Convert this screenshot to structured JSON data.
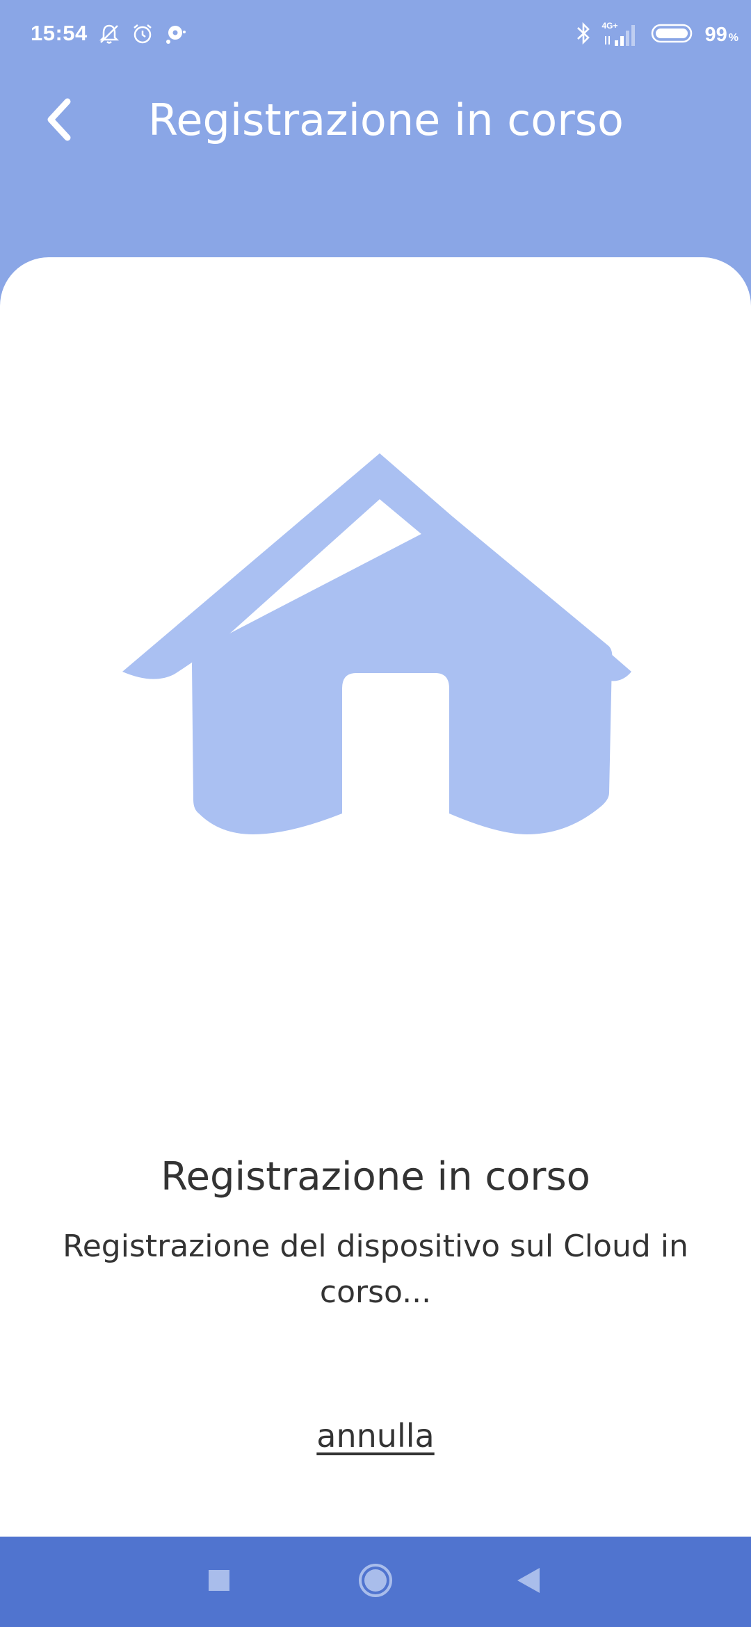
{
  "colors": {
    "header_background": "#8AA6E6",
    "card_background": "#FFFFFF",
    "house_fill": "#AAC0F2",
    "nav_bar_background": "#5074CF",
    "text_primary": "#333333"
  },
  "status_bar": {
    "time": "15:54",
    "left_icons": [
      "muted-bell-icon",
      "alarm-clock-icon",
      "notification-bubble-icon"
    ],
    "right_icons": [
      "bluetooth-icon",
      "signal-4g-icon",
      "battery-icon"
    ],
    "network_label": "4G+",
    "battery_percent": "99",
    "battery_unit": "%"
  },
  "header": {
    "title": "Registrazione in corso",
    "back_icon": "chevron-left-icon"
  },
  "content": {
    "illustration_icon": "house-icon",
    "title": "Registrazione in corso",
    "subtitle": "Registrazione del dispositivo sul Cloud in corso...",
    "cancel_label": "annulla"
  },
  "nav_bar": {
    "icons": [
      "square-recents-icon",
      "circle-home-icon",
      "triangle-back-icon"
    ]
  }
}
